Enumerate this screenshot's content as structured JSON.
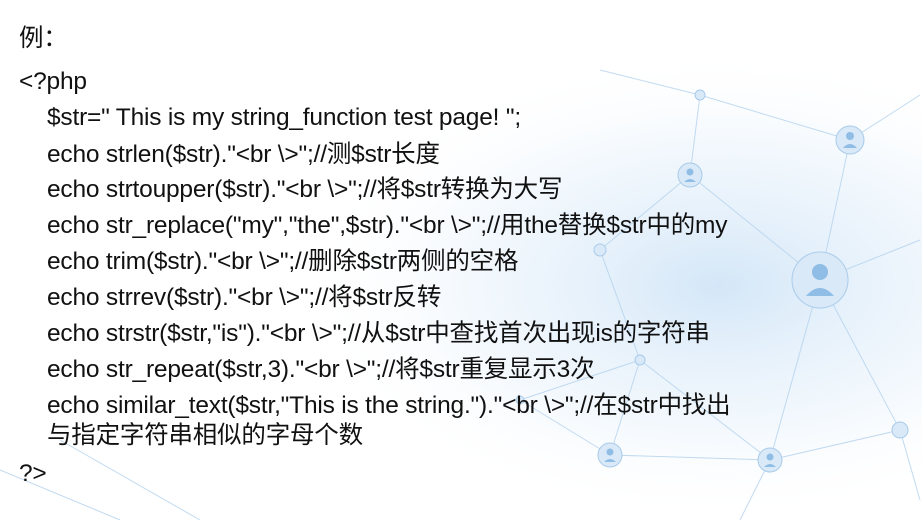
{
  "slide": {
    "heading": "例：",
    "open_tag": "<?php",
    "code_lines": [
      "$str=\"   This is my string_function test page!   \";",
      "echo strlen($str).\"<br \\>\";//测$str长度",
      "echo strtoupper($str).\"<br \\>\";//将$str转换为大写",
      "echo str_replace(\"my\",\"the\",$str).\"<br \\>\";//用the替换$str中的my",
      "echo trim($str).\"<br \\>\";//删除$str两侧的空格",
      "echo strrev($str).\"<br \\>\";//将$str反转",
      "echo strstr($str,\"is\").\"<br \\>\";//从$str中查找首次出现is的字符串",
      "echo str_repeat($str,3).\"<br \\>\";//将$str重复显示3次",
      "echo similar_text($str,\"This is the string.\").\"<br \\>\";//在$str中找出",
      "与指定字符串相似的字母个数"
    ],
    "close_tag": "?>"
  },
  "colors": {
    "text": "#111111",
    "background": "#ffffff",
    "network_accent": "#8fbde6"
  },
  "background_icons": [
    "user-node-icon"
  ]
}
